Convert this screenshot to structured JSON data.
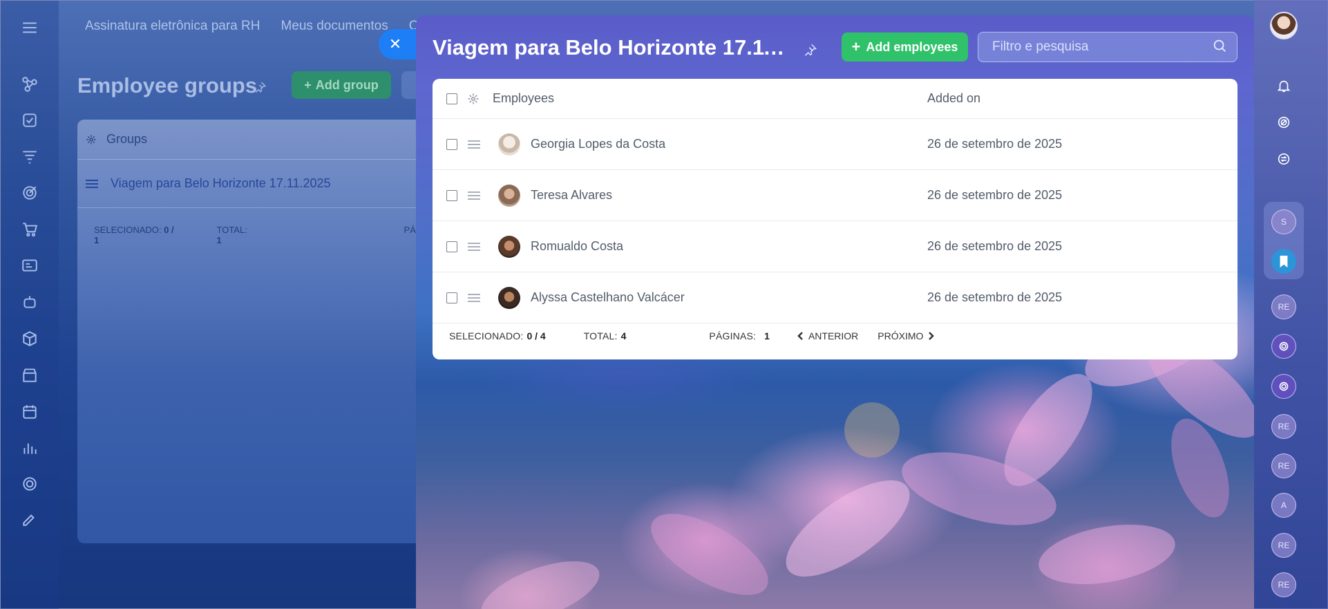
{
  "topnav": {
    "items": [
      "Assinatura eletrônica para RH",
      "Meus documentos",
      "Co"
    ]
  },
  "background_page": {
    "title": "Employee groups",
    "add_group_label": "Add group",
    "panel": {
      "column_header": "Groups",
      "row": "Viagem para Belo Horizonte 17.11.2025",
      "selected_label": "SELECIONADO:",
      "selected_value": "0 / 1",
      "total_label": "TOTAL:",
      "total_value": "1",
      "pages_partial": "PÁG"
    }
  },
  "slider": {
    "close_icon": "close-icon",
    "title": "Viagem para Belo Horizonte 17.11.2...",
    "add_employees_label": "Add employees",
    "search_placeholder": "Filtro e pesquisa",
    "grid": {
      "columns": {
        "employees": "Employees",
        "added_on": "Added on"
      },
      "rows": [
        {
          "name": "Georgia Lopes da Costa",
          "added_on": "26 de setembro de 2025",
          "avatar_color": "#c9b8a8"
        },
        {
          "name": "Teresa Alvares",
          "added_on": "26 de setembro de 2025",
          "avatar_color": "#8a6a55"
        },
        {
          "name": "Romualdo Costa",
          "added_on": "26 de setembro de 2025",
          "avatar_color": "#5a3a2a"
        },
        {
          "name": "Alyssa Castelhano Valcácer",
          "added_on": "26 de setembro de 2025",
          "avatar_color": "#3b2a22"
        }
      ],
      "footer": {
        "selected_label": "SELECIONADO:",
        "selected_value": "0 / 4",
        "total_label": "TOTAL:",
        "total_value": "4",
        "pages_label": "PÁGINAS:",
        "pages_value": "1",
        "prev_label": "ANTERIOR",
        "next_label": "PRÓXIMO"
      }
    }
  },
  "right_rail": {
    "bubbles": [
      "S",
      "RE",
      "RE",
      "RE",
      "A",
      "RE",
      "RE"
    ]
  },
  "colors": {
    "accent_blue": "#1e7ef6",
    "success_green": "#2fc26a",
    "text_gray": "#525c69"
  }
}
